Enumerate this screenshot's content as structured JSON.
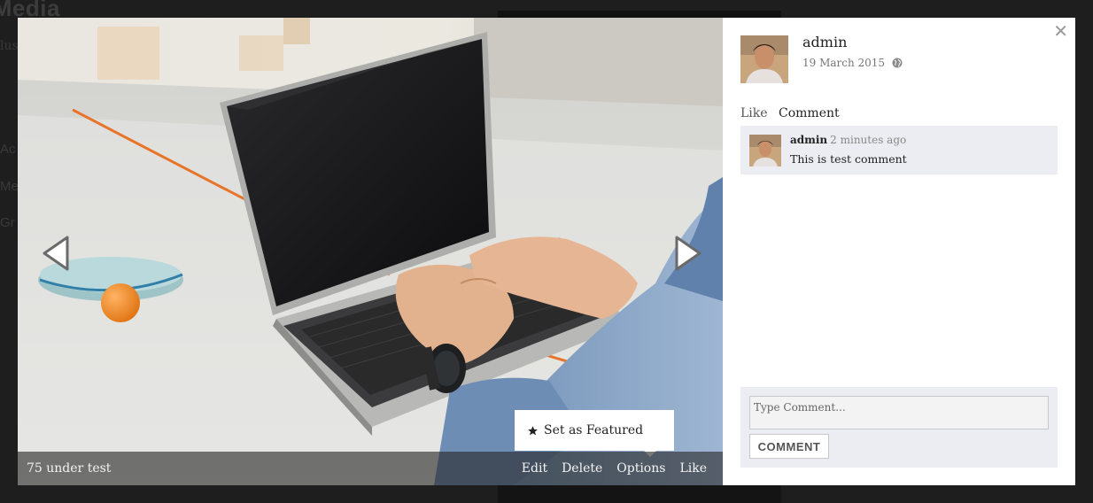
{
  "background": {
    "site_title": "rtMedia",
    "site_subtitle": "lus",
    "nav_items": [
      "Ac",
      "Me",
      "Gr"
    ]
  },
  "lightbox": {
    "media_title": "75 under test",
    "actions": {
      "edit": "Edit",
      "delete": "Delete",
      "options": "Options",
      "like": "Like"
    },
    "options_menu": {
      "set_featured": "Set as Featured",
      "icon": "star-icon"
    },
    "nav": {
      "prev_icon": "chevron-left-icon",
      "next_icon": "chevron-right-icon"
    },
    "close_icon": "close-icon"
  },
  "info": {
    "author": "admin",
    "date": "19 March 2015",
    "privacy_icon": "globe-icon",
    "links": {
      "like": "Like",
      "comment": "Comment"
    },
    "comments": [
      {
        "author": "admin",
        "time": "2 minutes ago",
        "text": "This is test comment"
      }
    ],
    "comment_form": {
      "placeholder": "Type Comment...",
      "submit_label": "COMMENT"
    }
  },
  "colors": {
    "overlay": "#1e1e1e",
    "caption_bar": "#282828",
    "comment_bg": "#ececf3"
  }
}
